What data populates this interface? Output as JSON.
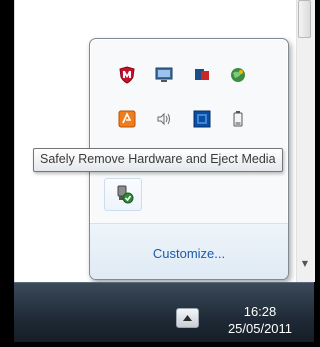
{
  "tooltip": {
    "text": "Safely Remove Hardware and Eject Media"
  },
  "overflow_panel": {
    "customize_label": "Customize...",
    "icons": [
      "mcafee-shield-icon",
      "monitor-icon",
      "network-security-icon",
      "globe-update-icon",
      "orange-app-icon",
      "speaker-volume-icon",
      "intel-graphics-icon",
      "battery-icon",
      "safely-remove-hardware-icon"
    ]
  },
  "taskbar": {
    "time": "16:28",
    "date": "25/05/2011",
    "show_hidden_icon": "triangle-up-icon"
  },
  "colors": {
    "link": "#1e5aa8",
    "taskbar_top": "#3b4a5a",
    "taskbar_bottom": "#151d26"
  }
}
